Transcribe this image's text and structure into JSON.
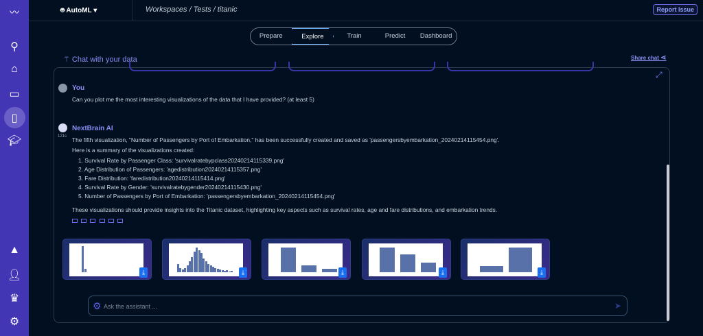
{
  "app": {
    "brand": "AutoML ▾",
    "report_issue": "Report Issue"
  },
  "breadcrumb": "Workspaces / Tests / titanic",
  "sidebar": {
    "icons": [
      "logo-wave-icon",
      "search-icon",
      "home-icon",
      "folder-icon",
      "document-icon",
      "graduation-cap-icon",
      "warning-icon",
      "user-settings-icon",
      "crown-icon",
      "gear-icon"
    ]
  },
  "stepper": [
    "Prepare",
    "Explore",
    "Train",
    "Predict",
    "Dashboard"
  ],
  "stepper_active": "Explore",
  "chat": {
    "title": "Chat with your data",
    "share": "Share chat"
  },
  "messages": {
    "user": {
      "name": "You",
      "text": "Can you plot me the most interesting visualizations of the data that I have provided? (at least 5)"
    },
    "ai": {
      "name": "NextBrain AI",
      "time": "121s",
      "intro": "The fifth visualization, \"Number of Passengers by Port of Embarkation,\" has been successfully created and saved as 'passengersbyembarkation_20240214115454.png'.",
      "summary": "Here is a summary of the visualizations created:",
      "items": [
        "1. Survival Rate by Passenger Class: 'survivalratebypclass20240214115339.png'",
        "2. Age Distribution of Passengers: 'agedistribution20240214115357.png'",
        "3. Fare Distribution: 'faredistribution20240214115414.png'",
        "4. Survival Rate by Gender: 'survivalratebygender20240214115430.png'",
        "5. Number of Passengers by Port of Embarkation: 'passengersbyembarkation_20240214115454.png'"
      ],
      "outro": "These visualizations should provide insights into the Titanic dataset, highlighting key aspects such as survival rates, age and fare distributions, and embarkation trends."
    }
  },
  "input": {
    "placeholder": "Ask the assistant ..."
  },
  "colors": {
    "sidebar": "#4336b4",
    "accent": "#8a8ff0",
    "background": "#010f20",
    "download": "#1a6ff0"
  }
}
